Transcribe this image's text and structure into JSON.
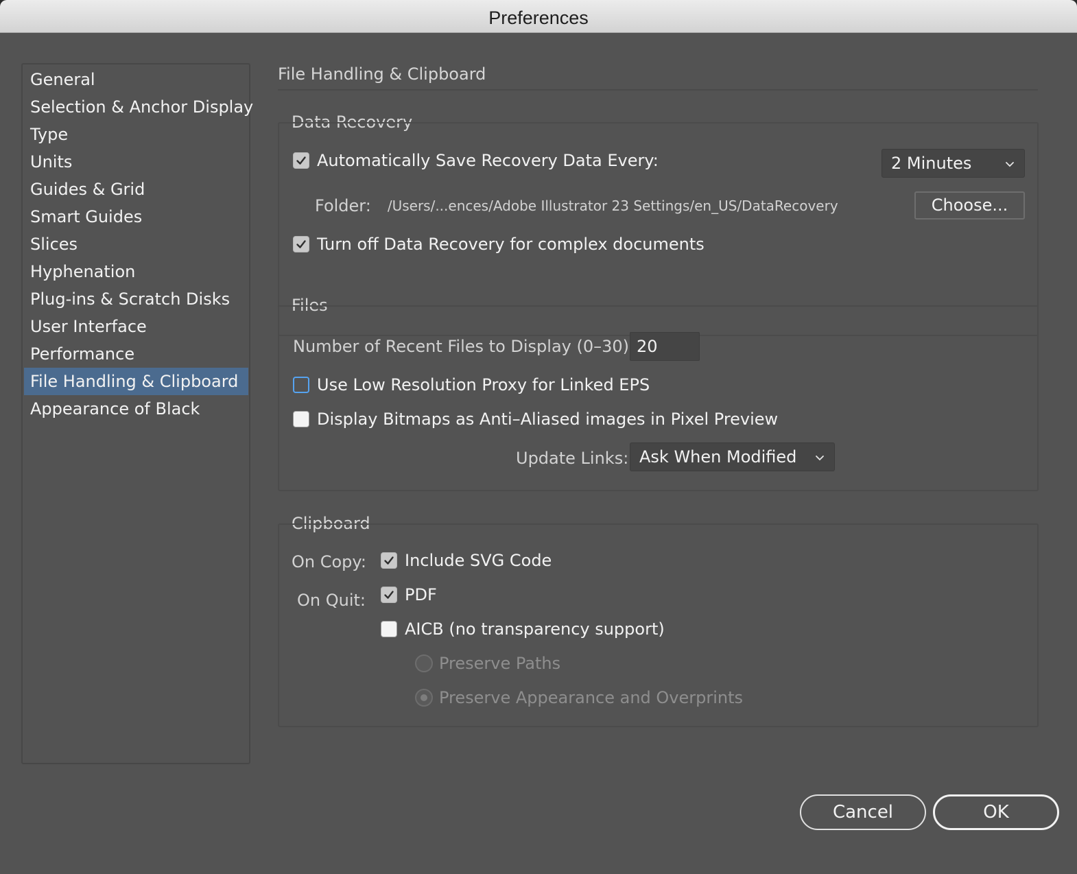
{
  "window": {
    "title": "Preferences"
  },
  "sidebar": {
    "items": [
      {
        "label": "General"
      },
      {
        "label": "Selection & Anchor Display"
      },
      {
        "label": "Type"
      },
      {
        "label": "Units"
      },
      {
        "label": "Guides & Grid"
      },
      {
        "label": "Smart Guides"
      },
      {
        "label": "Slices"
      },
      {
        "label": "Hyphenation"
      },
      {
        "label": "Plug-ins & Scratch Disks"
      },
      {
        "label": "User Interface"
      },
      {
        "label": "Performance"
      },
      {
        "label": "File Handling & Clipboard",
        "selected": true
      },
      {
        "label": "Appearance of Black"
      }
    ]
  },
  "page": {
    "title": "File Handling & Clipboard"
  },
  "data_recovery": {
    "title": "Data Recovery",
    "auto_save": {
      "label": "Automatically Save Recovery Data Every:",
      "checked": true
    },
    "interval": {
      "value": "2 Minutes"
    },
    "folder_label": "Folder:",
    "folder_path": "/Users/...ences/Adobe Illustrator 23 Settings/en_US/DataRecovery",
    "choose_label": "Choose...",
    "turn_off": {
      "label": "Turn off Data Recovery for complex documents",
      "checked": true
    }
  },
  "files": {
    "title": "Files",
    "recent_label": "Number of Recent Files to Display (0–30):",
    "recent_value": "20",
    "low_res": {
      "label": "Use Low Resolution Proxy for Linked EPS",
      "checked": false
    },
    "anti_alias": {
      "label": "Display Bitmaps as Anti–Aliased images in Pixel Preview",
      "checked": false
    },
    "update_links_label": "Update Links:",
    "update_links_value": "Ask When Modified"
  },
  "clipboard": {
    "title": "Clipboard",
    "on_copy_label": "On Copy:",
    "include_svg": {
      "label": "Include SVG Code",
      "checked": true
    },
    "on_quit_label": "On Quit:",
    "pdf": {
      "label": "PDF",
      "checked": true
    },
    "aicb": {
      "label": "AICB (no transparency support)",
      "checked": false
    },
    "preserve_paths": {
      "label": "Preserve Paths",
      "selected": false
    },
    "preserve_appearance": {
      "label": "Preserve Appearance and Overprints",
      "selected": true
    }
  },
  "footer": {
    "cancel_label": "Cancel",
    "ok_label": "OK"
  },
  "colors": {
    "selection": "#4b6b8f",
    "focus": "#56a3f0",
    "panel": "#535353"
  }
}
